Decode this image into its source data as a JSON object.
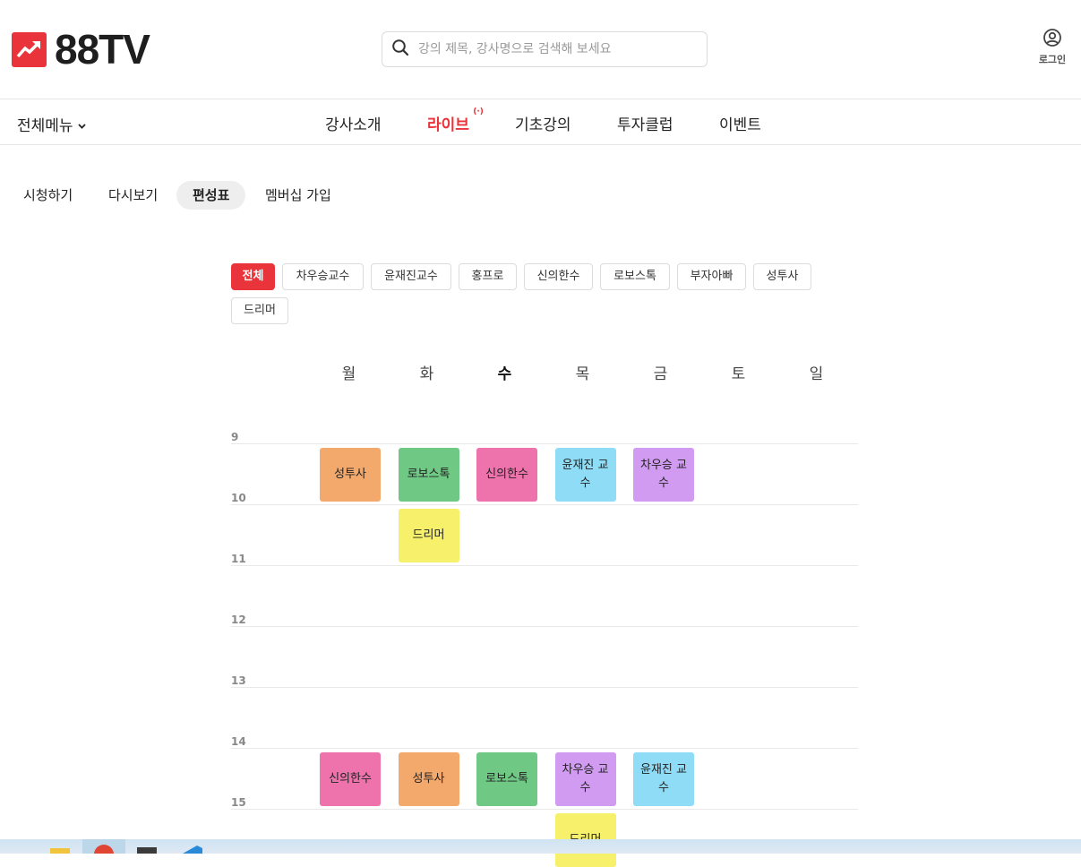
{
  "brand": {
    "name": "88TV",
    "accent": "#e8343a"
  },
  "search": {
    "placeholder": "강의 제목, 강사명으로 검색해 보세요"
  },
  "account": {
    "login_label": "로그인"
  },
  "nav": {
    "all_menu_label": "전체메뉴",
    "items": [
      {
        "label": "강사소개"
      },
      {
        "label": "라이브",
        "badge": "(·)",
        "active": true
      },
      {
        "label": "기초강의"
      },
      {
        "label": "투자클럽"
      },
      {
        "label": "이벤트"
      }
    ]
  },
  "subtabs": [
    {
      "label": "시청하기"
    },
    {
      "label": "다시보기"
    },
    {
      "label": "편성표",
      "active": true
    },
    {
      "label": "멤버십 가입"
    }
  ],
  "filters": [
    {
      "label": "전체",
      "active": true
    },
    {
      "label": "차우승교수"
    },
    {
      "label": "윤재진교수"
    },
    {
      "label": "홍프로"
    },
    {
      "label": "신의한수"
    },
    {
      "label": "로보스톡"
    },
    {
      "label": "부자아빠"
    },
    {
      "label": "성투사"
    },
    {
      "label": "드리머"
    }
  ],
  "schedule": {
    "days": [
      "월",
      "화",
      "수",
      "목",
      "금",
      "토",
      "일"
    ],
    "today": "수",
    "hours": [
      "9",
      "10",
      "11",
      "12",
      "13",
      "14",
      "15"
    ],
    "colors": {
      "성투사": "#f4a96c",
      "로보스톡": "#6fc985",
      "신의한수": "#ee72ab",
      "윤재진교수": "#8edcf5",
      "차우승교수": "#d19bf2",
      "드리머": "#f7f06a"
    },
    "programs": [
      {
        "day": "월",
        "start": 9,
        "label": "성투사",
        "key": "성투사"
      },
      {
        "day": "화",
        "start": 9,
        "label": "로보스톡",
        "key": "로보스톡"
      },
      {
        "day": "수",
        "start": 9,
        "label": "신의한수",
        "key": "신의한수"
      },
      {
        "day": "목",
        "start": 9,
        "label": "윤재진 교수",
        "key": "윤재진교수"
      },
      {
        "day": "금",
        "start": 9,
        "label": "차우승 교수",
        "key": "차우승교수"
      },
      {
        "day": "화",
        "start": 10,
        "label": "드리머",
        "key": "드리머"
      },
      {
        "day": "월",
        "start": 14,
        "label": "신의한수",
        "key": "신의한수"
      },
      {
        "day": "화",
        "start": 14,
        "label": "성투사",
        "key": "성투사"
      },
      {
        "day": "수",
        "start": 14,
        "label": "로보스톡",
        "key": "로보스톡"
      },
      {
        "day": "목",
        "start": 14,
        "label": "차우승 교수",
        "key": "차우승교수"
      },
      {
        "day": "금",
        "start": 14,
        "label": "윤재진 교수",
        "key": "윤재진교수"
      },
      {
        "day": "목",
        "start": 15,
        "label": "드리머",
        "key": "드리머"
      }
    ]
  }
}
